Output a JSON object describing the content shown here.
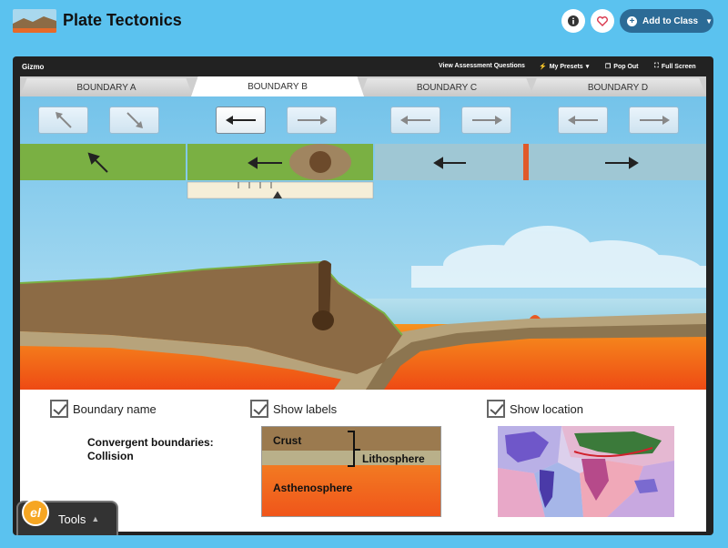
{
  "header": {
    "title": "Plate Tectonics",
    "add_to_class_label": "Add to Class",
    "info_icon": "info-icon",
    "favorite_icon": "heart-icon"
  },
  "gizmo": {
    "label": "Gizmo",
    "actions": {
      "assessment": "View Assessment Questions",
      "presets": "My Presets",
      "popout": "Pop Out",
      "fullscreen": "Full Screen"
    },
    "tabs": [
      {
        "label": "BOUNDARY A",
        "active": false
      },
      {
        "label": "BOUNDARY B",
        "active": true
      },
      {
        "label": "BOUNDARY C",
        "active": false
      },
      {
        "label": "BOUNDARY D",
        "active": false
      }
    ]
  },
  "options": {
    "boundary_name": {
      "label": "Boundary name",
      "checked": true
    },
    "show_labels": {
      "label": "Show labels",
      "checked": true
    },
    "show_location": {
      "label": "Show location",
      "checked": true
    },
    "boundary_description": [
      "Convergent boundaries:",
      "Collision"
    ]
  },
  "layers": {
    "crust": "Crust",
    "lithosphere": "Lithosphere",
    "asthenosphere": "Asthenosphere"
  },
  "tools": {
    "label": "Tools"
  },
  "colors": {
    "background": "#5bc2ef",
    "accent": "#2c6b96",
    "magma": "#f0541a",
    "plate": "#8c6b45",
    "grass": "#7ab043",
    "ocean": "#a6d6e8"
  }
}
